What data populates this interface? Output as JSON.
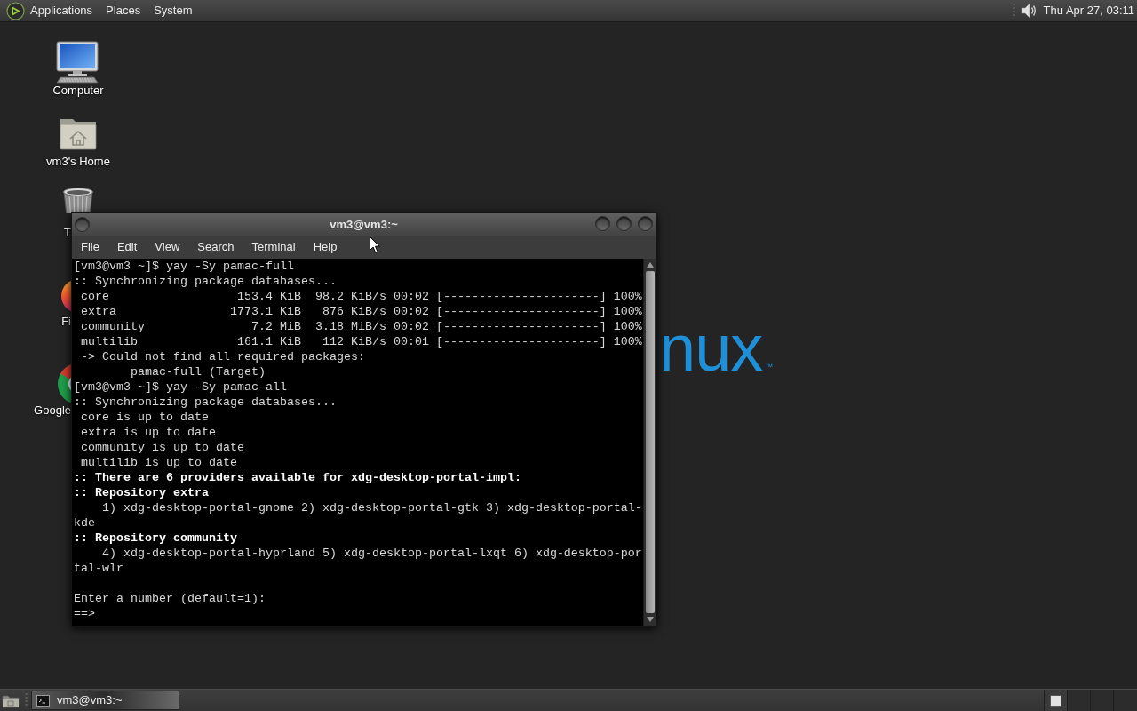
{
  "top_panel": {
    "menus": [
      "Applications",
      "Places",
      "System"
    ],
    "clock": "Thu Apr 27, 03:11"
  },
  "desktop_icons": [
    {
      "kind": "computer",
      "label": "Computer"
    },
    {
      "kind": "home",
      "label": "vm3's Home"
    },
    {
      "kind": "trash",
      "label": "T"
    },
    {
      "kind": "firefox",
      "label": "Fi"
    },
    {
      "kind": "chrome",
      "label": "Google"
    }
  ],
  "wallpaper": {
    "logo": "nux",
    "trademark": "™"
  },
  "terminal": {
    "title": "vm3@vm3:~",
    "menu": [
      "File",
      "Edit",
      "View",
      "Search",
      "Terminal",
      "Help"
    ],
    "lines": [
      {
        "kind": "normal",
        "text": "[vm3@vm3 ~]$ yay -Sy pamac-full"
      },
      {
        "kind": "normal",
        "text": ":: Synchronizing package databases..."
      },
      {
        "kind": "normal",
        "text": " core                  153.4 KiB  98.2 KiB/s 00:02 [----------------------] 100%"
      },
      {
        "kind": "normal",
        "text": " extra                1773.1 KiB   876 KiB/s 00:02 [----------------------] 100%"
      },
      {
        "kind": "normal",
        "text": " community               7.2 MiB  3.18 MiB/s 00:02 [----------------------] 100%"
      },
      {
        "kind": "normal",
        "text": " multilib              161.1 KiB   112 KiB/s 00:01 [----------------------] 100%"
      },
      {
        "kind": "normal",
        "text": " -> Could not find all required packages:"
      },
      {
        "kind": "normal",
        "text": "        pamac-full (Target)"
      },
      {
        "kind": "normal",
        "text": "[vm3@vm3 ~]$ yay -Sy pamac-all"
      },
      {
        "kind": "normal",
        "text": ":: Synchronizing package databases..."
      },
      {
        "kind": "normal",
        "text": " core is up to date"
      },
      {
        "kind": "normal",
        "text": " extra is up to date"
      },
      {
        "kind": "normal",
        "text": " community is up to date"
      },
      {
        "kind": "normal",
        "text": " multilib is up to date"
      },
      {
        "kind": "bold",
        "text": ":: There are 6 providers available for xdg-desktop-portal-impl:"
      },
      {
        "kind": "bold",
        "text": ":: Repository extra"
      },
      {
        "kind": "normal",
        "text": "    1) xdg-desktop-portal-gnome 2) xdg-desktop-portal-gtk 3) xdg-desktop-portal-"
      },
      {
        "kind": "normal",
        "text": "kde"
      },
      {
        "kind": "bold",
        "text": ":: Repository community"
      },
      {
        "kind": "normal",
        "text": "    4) xdg-desktop-portal-hyprland 5) xdg-desktop-portal-lxqt 6) xdg-desktop-por"
      },
      {
        "kind": "normal",
        "text": "tal-wlr"
      },
      {
        "kind": "blank"
      },
      {
        "kind": "normal",
        "text": "Enter a number (default=1):"
      },
      {
        "kind": "normal",
        "text": "==>"
      }
    ]
  },
  "bottom_panel": {
    "tasks": [
      {
        "label": "vm3@vm3:~",
        "selected": true
      }
    ]
  }
}
